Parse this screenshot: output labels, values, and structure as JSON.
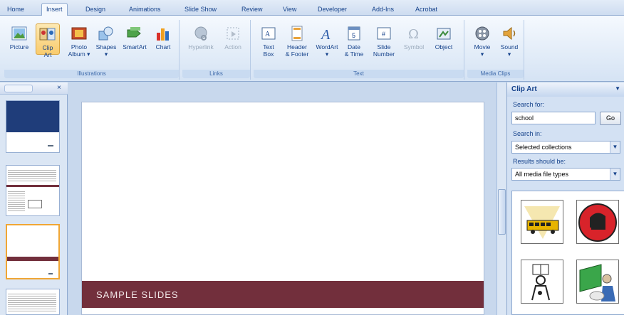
{
  "tabs": [
    "Home",
    "Insert",
    "Design",
    "Animations",
    "Slide Show",
    "Review",
    "View",
    "Developer",
    "Add-Ins",
    "Acrobat"
  ],
  "active_tab": "Insert",
  "groups": {
    "illustrations": {
      "label": "Illustrations",
      "buttons": [
        {
          "l1": "Picture",
          "l2": ""
        },
        {
          "l1": "Clip",
          "l2": "Art"
        },
        {
          "l1": "Photo",
          "l2": "Album ▾"
        },
        {
          "l1": "Shapes",
          "l2": "▾"
        },
        {
          "l1": "SmartArt",
          "l2": ""
        },
        {
          "l1": "Chart",
          "l2": ""
        }
      ]
    },
    "links": {
      "label": "Links",
      "buttons": [
        {
          "l1": "Hyperlink",
          "l2": ""
        },
        {
          "l1": "Action",
          "l2": ""
        }
      ]
    },
    "text": {
      "label": "Text",
      "buttons": [
        {
          "l1": "Text",
          "l2": "Box"
        },
        {
          "l1": "Header",
          "l2": "& Footer"
        },
        {
          "l1": "WordArt",
          "l2": "▾"
        },
        {
          "l1": "Date",
          "l2": "& Time"
        },
        {
          "l1": "Slide",
          "l2": "Number"
        },
        {
          "l1": "Symbol",
          "l2": ""
        },
        {
          "l1": "Object",
          "l2": ""
        }
      ]
    },
    "media": {
      "label": "Media Clips",
      "buttons": [
        {
          "l1": "Movie",
          "l2": "▾"
        },
        {
          "l1": "Sound",
          "l2": "▾"
        }
      ]
    }
  },
  "slide": {
    "title_bar": "SAMPLE SLIDES"
  },
  "clip_pane": {
    "title": "Clip Art",
    "search_for_label": "Search for:",
    "search_value": "school",
    "go_label": "Go",
    "search_in_label": "Search in:",
    "search_in_value": "Selected collections",
    "results_label": "Results should be:",
    "results_value": "All media file types"
  },
  "colors": {
    "accent": "#722f3c",
    "ribbon": "#dfe9f5",
    "selected": "#f9cb6d"
  }
}
